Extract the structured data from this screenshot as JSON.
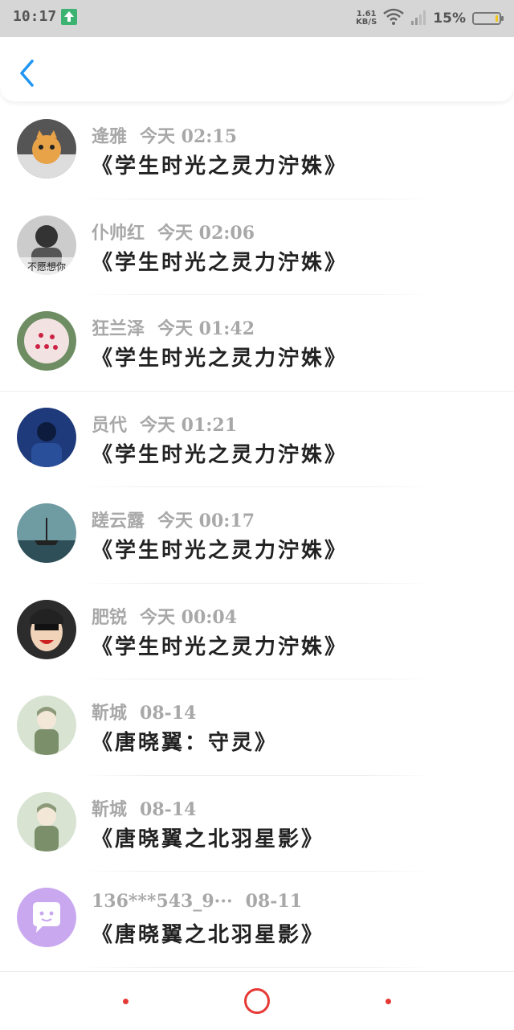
{
  "status_bar": {
    "time": "10:17",
    "net_speed_value": "1.61",
    "net_speed_unit": "KB/S",
    "battery_percent": "15%",
    "battery_level": 0.15
  },
  "items": [
    {
      "name": "逄雅",
      "time": "今天 02:15",
      "title": "《学生时光之灵力泞姝》",
      "avatar": "cat-avatar"
    },
    {
      "name": "仆帅红",
      "time": "今天 02:06",
      "title": "《学生时光之灵力泞姝》",
      "avatar": "photo-avatar",
      "avatar_caption": "不愿想你"
    },
    {
      "name": "狂兰泽",
      "time": "今天 01:42",
      "title": "《学生时光之灵力泞姝》",
      "avatar": "flower-avatar"
    },
    {
      "name": "员代",
      "time": "今天 01:21",
      "title": "《学生时光之灵力泞姝》",
      "avatar": "person-avatar"
    },
    {
      "name": "蹉云露",
      "time": "今天 00:17",
      "title": "《学生时光之灵力泞姝》",
      "avatar": "ship-avatar"
    },
    {
      "name": "肥锐",
      "time": "今天 00:04",
      "title": "《学生时光之灵力泞姝》",
      "avatar": "cartoon-avatar"
    },
    {
      "name": "靳城",
      "time": "08-14",
      "title": "《唐晓翼：守灵》",
      "avatar": "anime-avatar"
    },
    {
      "name": "靳城",
      "time": "08-14",
      "title": "《唐晓翼之北羽星影》",
      "avatar": "anime-avatar"
    },
    {
      "name": "136***543_9···",
      "time": "08-11",
      "title": "《唐晓翼之北羽星影》",
      "avatar": "chat-bubble-avatar"
    }
  ],
  "colors": {
    "accent": "#2196f3",
    "nav_red": "#e53935",
    "meta_gray": "#a8a8a8",
    "title_dark": "#222222"
  }
}
